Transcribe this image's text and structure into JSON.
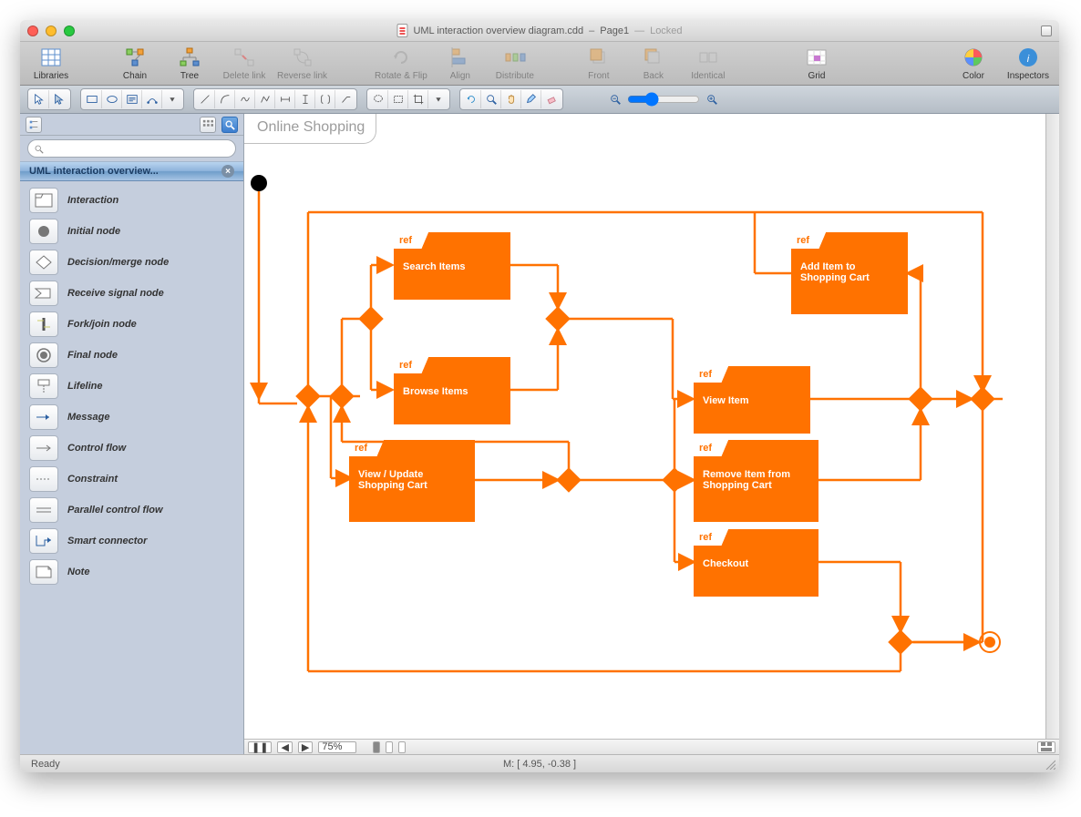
{
  "window": {
    "file_name": "UML interaction overview diagram.cdd",
    "page_label": "Page1",
    "locked_label": "Locked"
  },
  "toolbar": {
    "libraries": "Libraries",
    "chain": "Chain",
    "tree": "Tree",
    "delete_link": "Delete link",
    "reverse_link": "Reverse link",
    "rotate_flip": "Rotate & Flip",
    "align": "Align",
    "distribute": "Distribute",
    "front": "Front",
    "back": "Back",
    "identical": "Identical",
    "grid": "Grid",
    "color": "Color",
    "inspectors": "Inspectors"
  },
  "sidebar": {
    "library_title": "UML interaction overview...",
    "search_placeholder": "",
    "stencils": [
      {
        "label": "Interaction"
      },
      {
        "label": "Initial node"
      },
      {
        "label": "Decision/merge node"
      },
      {
        "label": "Receive signal node"
      },
      {
        "label": "Fork/join node"
      },
      {
        "label": "Final node"
      },
      {
        "label": "Lifeline"
      },
      {
        "label": "Message"
      },
      {
        "label": "Control flow"
      },
      {
        "label": "Constraint"
      },
      {
        "label": "Parallel control flow"
      },
      {
        "label": "Smart connector"
      },
      {
        "label": "Note"
      }
    ]
  },
  "canvas": {
    "frame_label": "Online Shopping",
    "zoom_value": "75%",
    "refs": [
      {
        "id": "search",
        "label": "Search Items",
        "ref": "ref"
      },
      {
        "id": "browse",
        "label": "Browse Items",
        "ref": "ref"
      },
      {
        "id": "viewupdate",
        "label": "View / Update Shopping Cart",
        "ref": "ref"
      },
      {
        "id": "viewitem",
        "label": "View Item",
        "ref": "ref"
      },
      {
        "id": "remove",
        "label": "Remove Item from Shopping Cart",
        "ref": "ref"
      },
      {
        "id": "checkout",
        "label": "Checkout",
        "ref": "ref"
      },
      {
        "id": "additem",
        "label": "Add Item to Shopping Cart",
        "ref": "ref"
      }
    ]
  },
  "status": {
    "ready": "Ready",
    "mouse_pos": "M: [ 4.95, -0.38 ]"
  },
  "colors": {
    "accent": "#ff7200"
  }
}
